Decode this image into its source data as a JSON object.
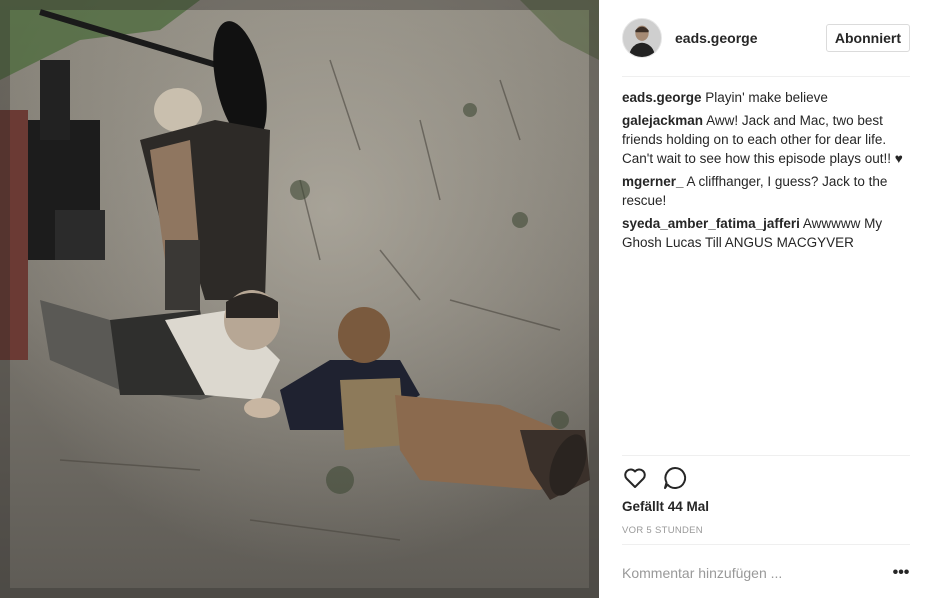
{
  "post": {
    "username": "eads.george",
    "follow_label": "Abonniert",
    "image_alt": "Behind-the-scenes photo: two actors lying on a dirt road holding hands, film crew with camera and boom nearby"
  },
  "comments": [
    {
      "author": "eads.george",
      "text": "Playin' make believe"
    },
    {
      "author": "galejackman",
      "text": "Aww! Jack and Mac, two best friends holding on to each other for dear life. Can't wait to see how this episode plays out!! ♥"
    },
    {
      "author": "mgerner_",
      "text": "A cliffhanger, I guess? Jack to the rescue!"
    },
    {
      "author": "syeda_amber_fatima_jafferi",
      "text": "Awwwww My Ghosh Lucas Till ANGUS MACGYVER"
    }
  ],
  "actions": {
    "like_icon": "heart-icon",
    "comment_icon": "speech-bubble-icon"
  },
  "likes_label": "Gefällt 44 Mal",
  "timestamp": "VOR 5 STUNDEN",
  "comment_box": {
    "placeholder": "Kommentar hinzufügen ...",
    "more_label": "•••"
  }
}
